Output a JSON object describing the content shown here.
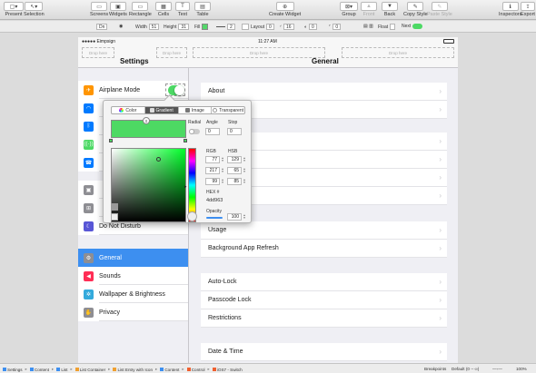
{
  "toolbar": {
    "items": [
      {
        "label": "Present",
        "glyph": "▢▾"
      },
      {
        "label": "Selection",
        "glyph": "↖▾"
      },
      {
        "label": "Screens",
        "glyph": "▭"
      },
      {
        "label": "Widgets",
        "glyph": "▣"
      },
      {
        "label": "Rectangle",
        "glyph": "▭"
      },
      {
        "label": "Cells",
        "glyph": "▦"
      },
      {
        "label": "Text",
        "glyph": "T"
      },
      {
        "label": "Table",
        "glyph": "▤"
      },
      {
        "label": "Create Widget",
        "glyph": "⊕"
      },
      {
        "label": "Group",
        "glyph": "⊠▾"
      },
      {
        "label": "Front",
        "glyph": "▲"
      },
      {
        "label": "Back",
        "glyph": "▼"
      },
      {
        "label": "Copy Style",
        "glyph": "✎"
      },
      {
        "label": "Paste Style",
        "glyph": "✎"
      },
      {
        "label": "Inspectors",
        "glyph": "ℹ"
      },
      {
        "label": "Export",
        "glyph": "⇪"
      }
    ]
  },
  "inspector": {
    "mode": "Dn",
    "width_label": "Width",
    "width_value": "51",
    "height_label": "Height",
    "height_value": "31",
    "fill_label": "Fill",
    "stroke_value": "2",
    "layout_label": "Layout",
    "layout_value": "0",
    "radius_value": "16",
    "opacity_value": "0",
    "corner_value": "0",
    "float_label": "Float",
    "next_label": "Next"
  },
  "status_bar": {
    "carrier": "●●●●● Eimpsign",
    "time": "11:27 AM"
  },
  "nav": {
    "master_title": "Settings",
    "detail_title": "General",
    "drop_left": "Drop here",
    "drop_right": "Drop here",
    "drop_mid": "Drop here",
    "drop_far": "Drop here"
  },
  "master_rows": [
    {
      "label": "Airplane Mode",
      "icon": "airplane-icon",
      "color": "#ff9500",
      "glyph": "✈"
    },
    {
      "label": "",
      "icon": "wifi-icon",
      "color": "#007aff",
      "glyph": "◠"
    },
    {
      "label": "",
      "icon": "bluetooth-icon",
      "color": "#007aff",
      "glyph": "ᛒ"
    },
    {
      "label": "",
      "icon": "cellular-icon",
      "color": "#4cd964",
      "glyph": "((·))"
    },
    {
      "label": "",
      "icon": "phone-icon",
      "color": "#007aff",
      "glyph": "☎"
    },
    {
      "label": "",
      "icon": "notifications-icon",
      "color": "#8e8e93",
      "glyph": "▣"
    },
    {
      "label": "",
      "icon": "control-center-icon",
      "color": "#8e8e93",
      "glyph": "⊞"
    },
    {
      "label": "Do Not Disturb",
      "icon": "moon-icon",
      "color": "#5856d6",
      "glyph": "☾"
    },
    {
      "label": "General",
      "icon": "gear-icon",
      "color": "#8e8e93",
      "glyph": "⚙"
    },
    {
      "label": "Sounds",
      "icon": "speaker-icon",
      "color": "#ff2d55",
      "glyph": "◀"
    },
    {
      "label": "Wallpaper & Brightness",
      "icon": "brightness-icon",
      "color": "#34aadc",
      "glyph": "✲"
    },
    {
      "label": "Privacy",
      "icon": "hand-icon",
      "color": "#8e8e93",
      "glyph": "✋"
    }
  ],
  "detail_rows": [
    {
      "label": "About"
    },
    {
      "label": ""
    },
    {
      "label": ""
    },
    {
      "label": ""
    },
    {
      "label": ""
    },
    {
      "label": ""
    },
    {
      "label": "Usage"
    },
    {
      "label": "Background App Refresh"
    },
    {
      "label": "Auto-Lock"
    },
    {
      "label": "Passcode Lock"
    },
    {
      "label": "Restrictions"
    },
    {
      "label": "Date & Time"
    }
  ],
  "color_picker": {
    "tabs": [
      "Color",
      "Gradient",
      "Image",
      "Transparent"
    ],
    "active_tab": "Gradient",
    "radial_label": "Radial",
    "angle_label": "Angle",
    "angle_value": "0",
    "stop_label": "Stop",
    "stop_value": "0",
    "rgb_label": "RGB",
    "hsb_label": "HSB",
    "r": "77",
    "g": "217",
    "b": "99",
    "h": "129",
    "s": "65",
    "br": "85",
    "hex_label": "HEX #",
    "hex_value": "4dd963",
    "opacity_label": "Opacity",
    "opacity_value": "100",
    "current_color": "#4dd963"
  },
  "breadcrumbs": [
    "Settings",
    "Content",
    "List",
    "List Container",
    "List Entry with Icon",
    "Content",
    "Control",
    "iOS7 - Switch"
  ],
  "footer": {
    "breakpoints_label": "Breakpoints",
    "breakpoint_value": "Default (0 -- ∞)",
    "zoom": "100%"
  }
}
